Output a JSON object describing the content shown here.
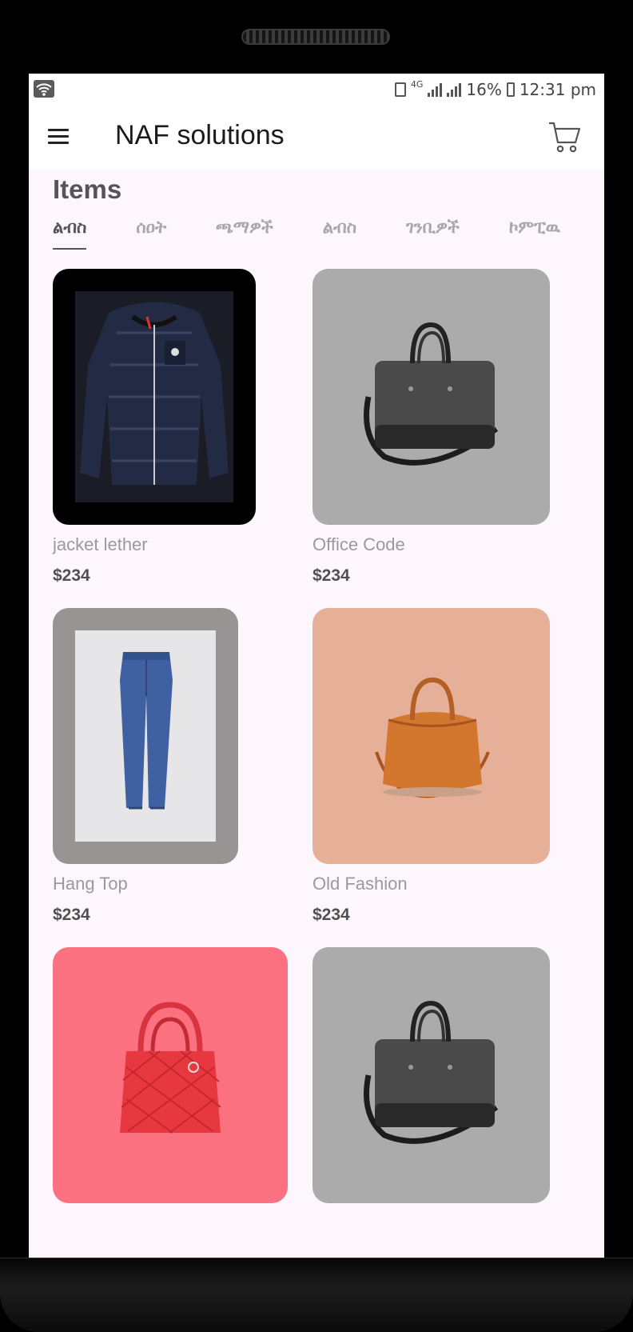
{
  "status_bar": {
    "network": "4G",
    "battery": "16%",
    "time": "12:31 pm"
  },
  "app_bar": {
    "title": "NAF solutions",
    "menu_icon": "hamburger-menu-icon",
    "cart_icon": "shopping-cart-icon"
  },
  "section": {
    "title": "Items"
  },
  "tabs": [
    {
      "label": "ልብስ",
      "active": true
    },
    {
      "label": "ሰዐት",
      "active": false
    },
    {
      "label": "ጫማዎች",
      "active": false
    },
    {
      "label": "ልብስ",
      "active": false
    },
    {
      "label": "ገንቢዎች",
      "active": false
    },
    {
      "label": "ኮምፒዉ",
      "active": false
    }
  ],
  "products": [
    {
      "name": "jacket lether",
      "price": "$234",
      "bg": "#000000",
      "image": "puffer-jacket"
    },
    {
      "name": "Office Code",
      "price": "$234",
      "bg": "#ababab",
      "image": "grey-laptop-bag"
    },
    {
      "name": "Hang Top",
      "price": "$234",
      "bg": "#979494",
      "image": "blue-jeans"
    },
    {
      "name": "Old Fashion",
      "price": "$234",
      "bg": "#e5b097",
      "image": "tan-duffel-bag"
    },
    {
      "name": "",
      "price": "",
      "bg": "#fb7180",
      "image": "red-quilted-handbag"
    },
    {
      "name": "",
      "price": "",
      "bg": "#ababab",
      "image": "grey-laptop-bag"
    }
  ],
  "colors": {
    "screen_bg": "#fdf6fd",
    "appbar_bg": "#ffffff",
    "title_text": "#555555",
    "inactive_tab": "#a8a8a8"
  }
}
